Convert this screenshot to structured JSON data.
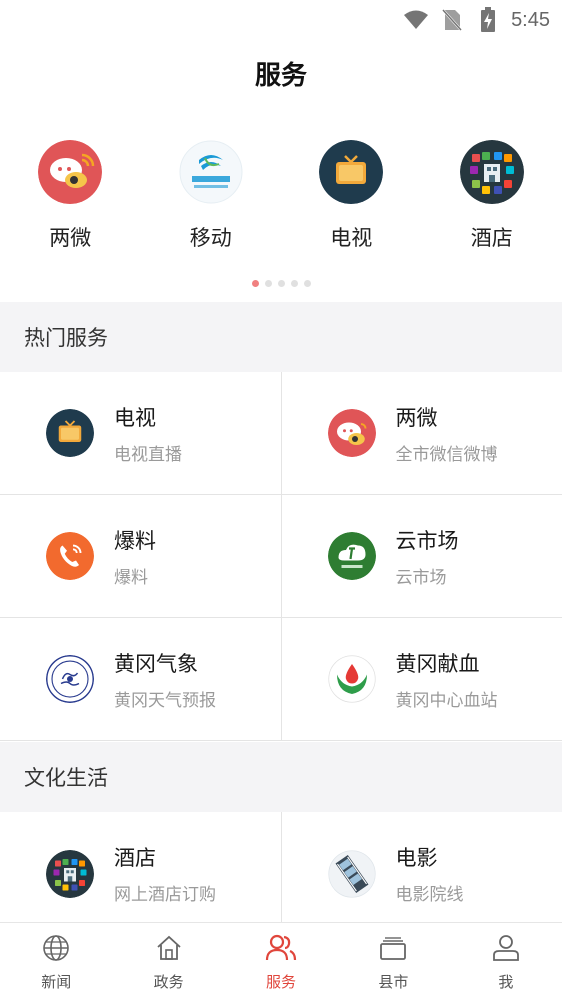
{
  "status_bar": {
    "time": "5:45"
  },
  "header": {
    "title": "服务"
  },
  "carousel": {
    "items": [
      {
        "label": "两微",
        "icon": "weibo-wechat-icon"
      },
      {
        "label": "移动",
        "icon": "china-mobile-icon"
      },
      {
        "label": "电视",
        "icon": "tv-icon"
      },
      {
        "label": "酒店",
        "icon": "hotel-icon"
      }
    ],
    "page_count": 5,
    "active_page": 1
  },
  "sections": [
    {
      "title": "热门服务",
      "items": [
        {
          "title": "电视",
          "subtitle": "电视直播",
          "icon": "tv-icon"
        },
        {
          "title": "两微",
          "subtitle": "全市微信微博",
          "icon": "weibo-wechat-icon"
        },
        {
          "title": "爆料",
          "subtitle": "爆料",
          "icon": "phone-icon"
        },
        {
          "title": "云市场",
          "subtitle": "云市场",
          "icon": "cloud-market-icon"
        },
        {
          "title": "黄冈气象",
          "subtitle": "黄冈天气预报",
          "icon": "weather-icon"
        },
        {
          "title": "黄冈献血",
          "subtitle": "黄冈中心血站",
          "icon": "blood-donation-icon"
        }
      ]
    },
    {
      "title": "文化生活",
      "items": [
        {
          "title": "酒店",
          "subtitle": "网上酒店订购",
          "icon": "hotel-icon"
        },
        {
          "title": "电影",
          "subtitle": "电影院线",
          "icon": "film-icon"
        }
      ]
    }
  ],
  "bottom_nav": {
    "items": [
      {
        "label": "新闻",
        "icon": "globe-icon"
      },
      {
        "label": "政务",
        "icon": "home-icon"
      },
      {
        "label": "服务",
        "icon": "people-icon"
      },
      {
        "label": "县市",
        "icon": "folders-icon"
      },
      {
        "label": "我",
        "icon": "person-icon"
      }
    ],
    "active": "服务"
  },
  "colors": {
    "accent": "#e0463c",
    "section_bg": "#f4f4f6"
  }
}
